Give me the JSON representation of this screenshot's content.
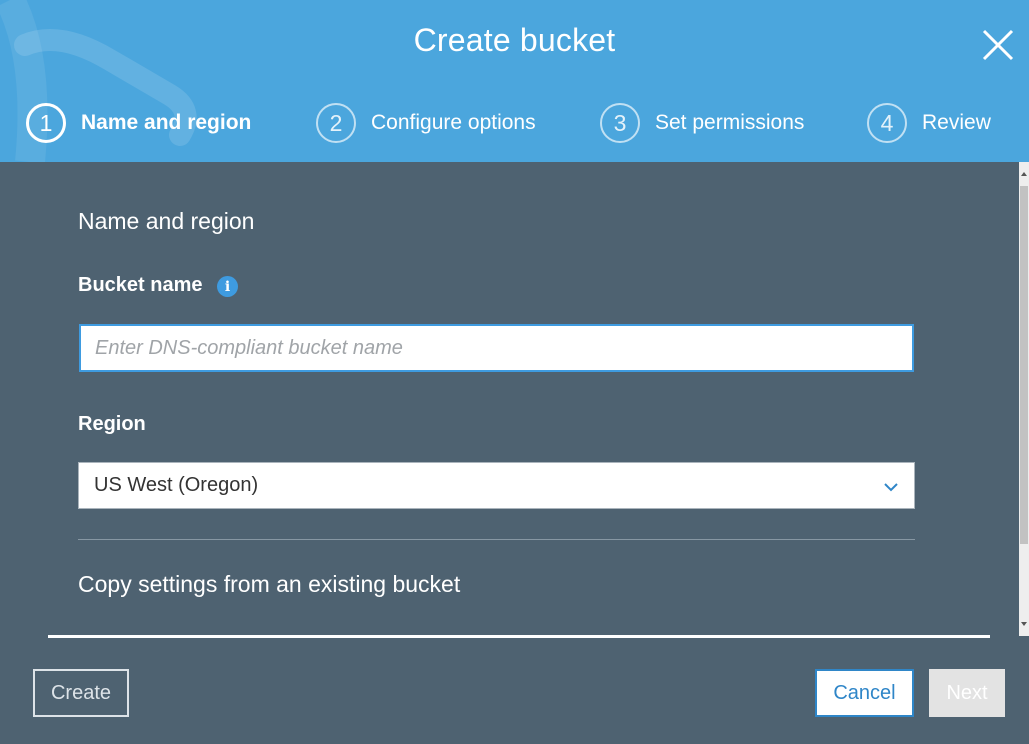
{
  "dialog": {
    "title": "Create bucket"
  },
  "steps": [
    {
      "number": "1",
      "label": "Name and region",
      "active": true
    },
    {
      "number": "2",
      "label": "Configure options",
      "active": false
    },
    {
      "number": "3",
      "label": "Set permissions",
      "active": false
    },
    {
      "number": "4",
      "label": "Review",
      "active": false
    }
  ],
  "form": {
    "section_title": "Name and region",
    "bucket_name": {
      "label": "Bucket name",
      "value": "",
      "placeholder": "Enter DNS-compliant bucket name"
    },
    "region": {
      "label": "Region",
      "selected": "US West (Oregon)"
    },
    "copy_settings_label": "Copy settings from an existing bucket"
  },
  "footer": {
    "create_label": "Create",
    "cancel_label": "Cancel",
    "next_label": "Next"
  },
  "colors": {
    "header_bg": "#4ba6dd",
    "body_bg": "#4e6271",
    "accent": "#2f86c8",
    "info_icon": "#3e9be0"
  },
  "icons": {
    "close": "close-icon",
    "info": "info-icon",
    "dropdown": "chevron-down-icon"
  }
}
